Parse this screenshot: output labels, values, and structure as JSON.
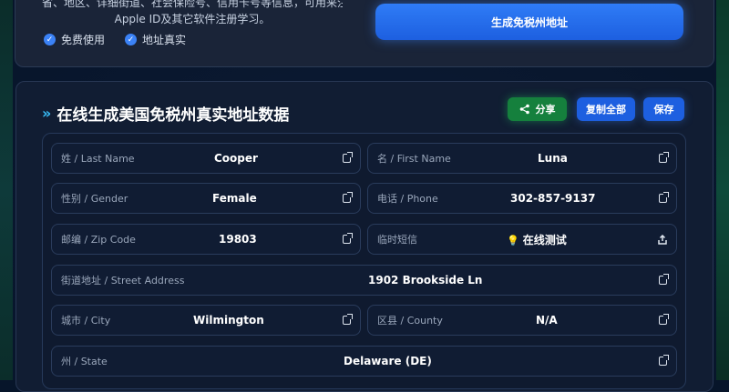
{
  "top": {
    "description_line1": "省、地区、详细街道、社会保险号、信用卡号等信息，可用来注册",
    "description_line2": "Apple ID及其它软件注册学习。",
    "features": [
      "免费使用",
      "地址真实"
    ],
    "generate_button": "生成免税州地址"
  },
  "main": {
    "title": "在线生成美国免税州真实地址数据",
    "share_label": "分享",
    "copy_all_label": "复制全部",
    "save_label": "保存"
  },
  "fields": {
    "last_name": {
      "label": "姓 / Last Name",
      "value": "Cooper"
    },
    "first_name": {
      "label": "名 / First Name",
      "value": "Luna"
    },
    "gender": {
      "label": "性别 / Gender",
      "value": "Female"
    },
    "phone": {
      "label": "电话 / Phone",
      "value": "302-857-9137"
    },
    "zip": {
      "label": "邮编 / Zip Code",
      "value": "19803"
    },
    "sms": {
      "label": "临时短信",
      "value": "在线测试"
    },
    "street": {
      "label": "街道地址 / Street Address",
      "value": "1902 Brookside Ln"
    },
    "city": {
      "label": "城市 / City",
      "value": "Wilmington"
    },
    "county": {
      "label": "区县 / County",
      "value": "N/A"
    },
    "state": {
      "label": "州 / State",
      "value": "Delaware (DE)"
    }
  },
  "colors": {
    "accent": "#1d5fe0",
    "share": "#15803d",
    "background": "#0a1830"
  }
}
